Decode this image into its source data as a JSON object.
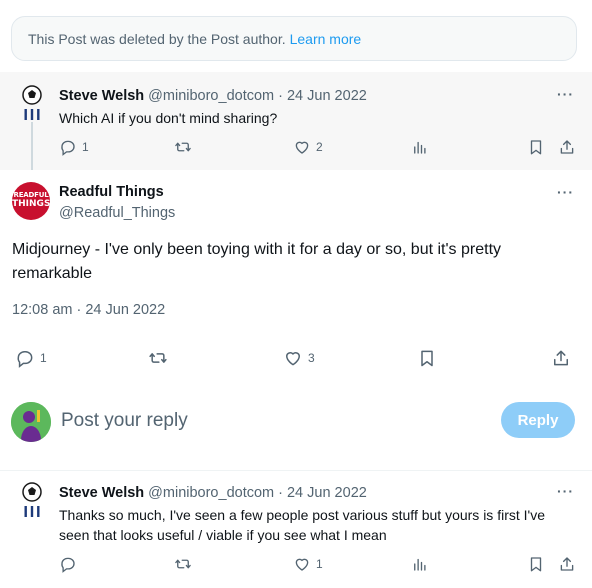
{
  "deleted_notice": {
    "text": "This Post was deleted by the Post author.",
    "link": "Learn more"
  },
  "reply_1": {
    "name": "Steve Welsh",
    "handle": "@miniboro_dotcom · 24 Jun 2022",
    "text": "Which AI if you don't mind sharing?",
    "replies": "1",
    "reposts": "",
    "likes": "2"
  },
  "main_tweet": {
    "name": "Readful Things",
    "handle": "@Readful_Things",
    "avatar_text_1": "READFUL",
    "avatar_text_2": "THINGS",
    "text": "Midjourney - I've only been toying with it for a day or so, but it's pretty remarkable",
    "timestamp": "12:08 am · 24 Jun 2022",
    "replies": "1",
    "likes": "3"
  },
  "compose": {
    "placeholder": "Post your reply",
    "button": "Reply"
  },
  "reply_2": {
    "name": "Steve Welsh",
    "handle": "@miniboro_dotcom · 24 Jun 2022",
    "text": "Thanks so much, I've seen a few people post various stuff but yours is first I've seen that looks useful / viable if you see what I mean",
    "replies": "",
    "likes": "1"
  },
  "more_label": "···",
  "colors": {
    "accent": "#1d9bf0",
    "reply_button_disabled": "#8ecdf8",
    "secondary_text": "#536471",
    "highlight_bg": "#f7f7f7"
  }
}
